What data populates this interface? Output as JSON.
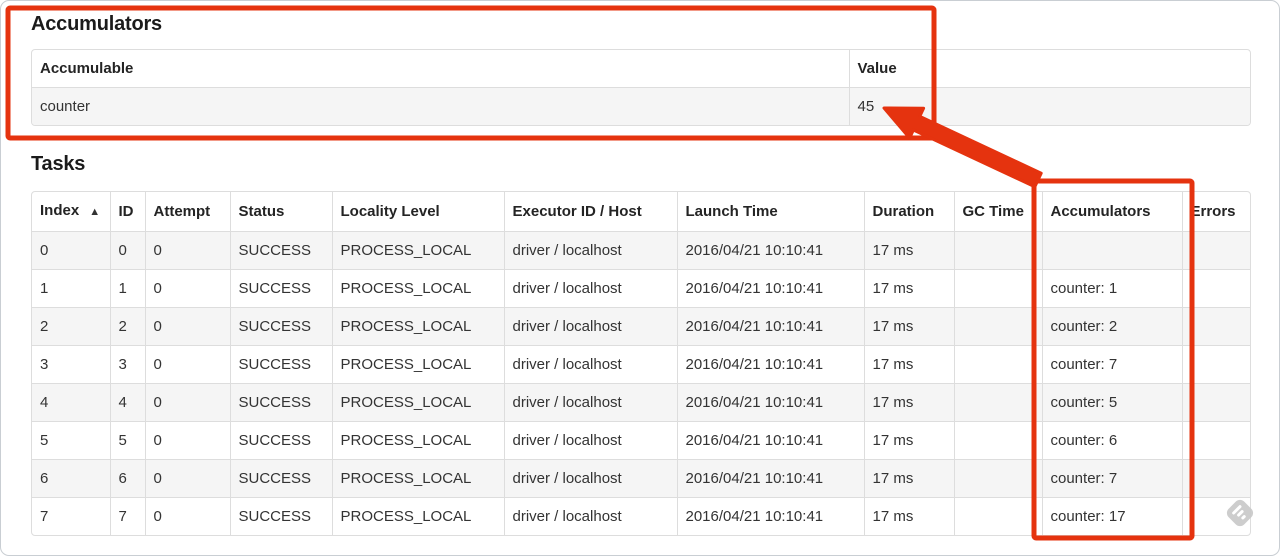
{
  "page": {
    "accumulators_section": {
      "title": "Accumulators",
      "table": {
        "headers": [
          "Accumulable",
          "Value"
        ],
        "rows": [
          [
            "counter",
            "45"
          ]
        ]
      }
    },
    "tasks_section": {
      "title": "Tasks",
      "table": {
        "headers": [
          "Index",
          "ID",
          "Attempt",
          "Status",
          "Locality Level",
          "Executor ID / Host",
          "Launch Time",
          "Duration",
          "GC Time",
          "Accumulators",
          "Errors"
        ],
        "sorted_column_index": 0,
        "sort_glyph": "▲",
        "rows": [
          [
            "0",
            "0",
            "0",
            "SUCCESS",
            "PROCESS_LOCAL",
            "driver / localhost",
            "2016/04/21 10:10:41",
            "17 ms",
            "",
            "",
            ""
          ],
          [
            "1",
            "1",
            "0",
            "SUCCESS",
            "PROCESS_LOCAL",
            "driver / localhost",
            "2016/04/21 10:10:41",
            "17 ms",
            "",
            "counter: 1",
            ""
          ],
          [
            "2",
            "2",
            "0",
            "SUCCESS",
            "PROCESS_LOCAL",
            "driver / localhost",
            "2016/04/21 10:10:41",
            "17 ms",
            "",
            "counter: 2",
            ""
          ],
          [
            "3",
            "3",
            "0",
            "SUCCESS",
            "PROCESS_LOCAL",
            "driver / localhost",
            "2016/04/21 10:10:41",
            "17 ms",
            "",
            "counter: 7",
            ""
          ],
          [
            "4",
            "4",
            "0",
            "SUCCESS",
            "PROCESS_LOCAL",
            "driver / localhost",
            "2016/04/21 10:10:41",
            "17 ms",
            "",
            "counter: 5",
            ""
          ],
          [
            "5",
            "5",
            "0",
            "SUCCESS",
            "PROCESS_LOCAL",
            "driver / localhost",
            "2016/04/21 10:10:41",
            "17 ms",
            "",
            "counter: 6",
            ""
          ],
          [
            "6",
            "6",
            "0",
            "SUCCESS",
            "PROCESS_LOCAL",
            "driver / localhost",
            "2016/04/21 10:10:41",
            "17 ms",
            "",
            "counter: 7",
            ""
          ],
          [
            "7",
            "7",
            "0",
            "SUCCESS",
            "PROCESS_LOCAL",
            "driver / localhost",
            "2016/04/21 10:10:41",
            "17 ms",
            "",
            "counter: 17",
            ""
          ]
        ]
      }
    }
  },
  "annotation": {
    "color": "#e5330f"
  },
  "watermark": {
    "name": "skitch-badge",
    "color": "#c9c9c9"
  }
}
